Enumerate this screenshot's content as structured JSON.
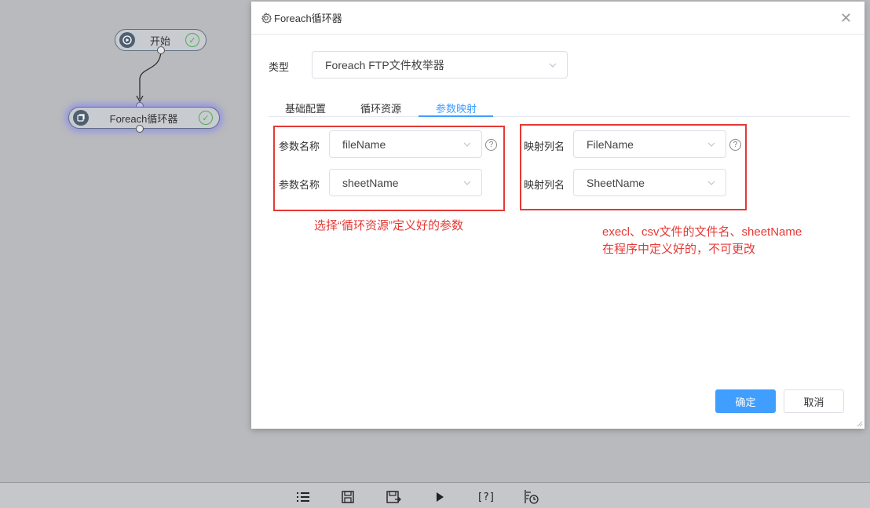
{
  "canvas": {
    "nodes": [
      {
        "label": "开始",
        "icon": "play-circle-icon",
        "status": "success-check-icon"
      },
      {
        "label": "Foreach循环器",
        "icon": "loop-node-icon",
        "status": "success-check-icon"
      }
    ]
  },
  "dialog": {
    "title": "Foreach循环器",
    "type_label": "类型",
    "type_value": "Foreach FTP文件枚举器",
    "tabs": [
      {
        "label": "基础配置",
        "active": false
      },
      {
        "label": "循环资源",
        "active": false
      },
      {
        "label": "参数映射",
        "active": true
      }
    ],
    "param_rows": [
      {
        "label": "参数名称",
        "value": "fileName"
      },
      {
        "label": "参数名称",
        "value": "sheetName"
      }
    ],
    "mapping_rows": [
      {
        "label": "映射列名",
        "value": "FileName"
      },
      {
        "label": "映射列名",
        "value": "SheetName"
      }
    ],
    "note_left": "选择“循环资源”定义好的参数",
    "note_right_line1": "execl、csv文件的文件名、sheetName",
    "note_right_line2": "在程序中定义好的，不可更改",
    "ok_label": "确定",
    "cancel_label": "取消"
  },
  "toolbar": {
    "items": [
      "list-icon",
      "save-icon",
      "save-as-icon",
      "run-icon",
      "help-bracket-icon",
      "schedule-icon"
    ],
    "help_text": "[?]"
  },
  "colors": {
    "accent": "#409eff",
    "annotation": "#e53935",
    "success": "#4caf50"
  }
}
